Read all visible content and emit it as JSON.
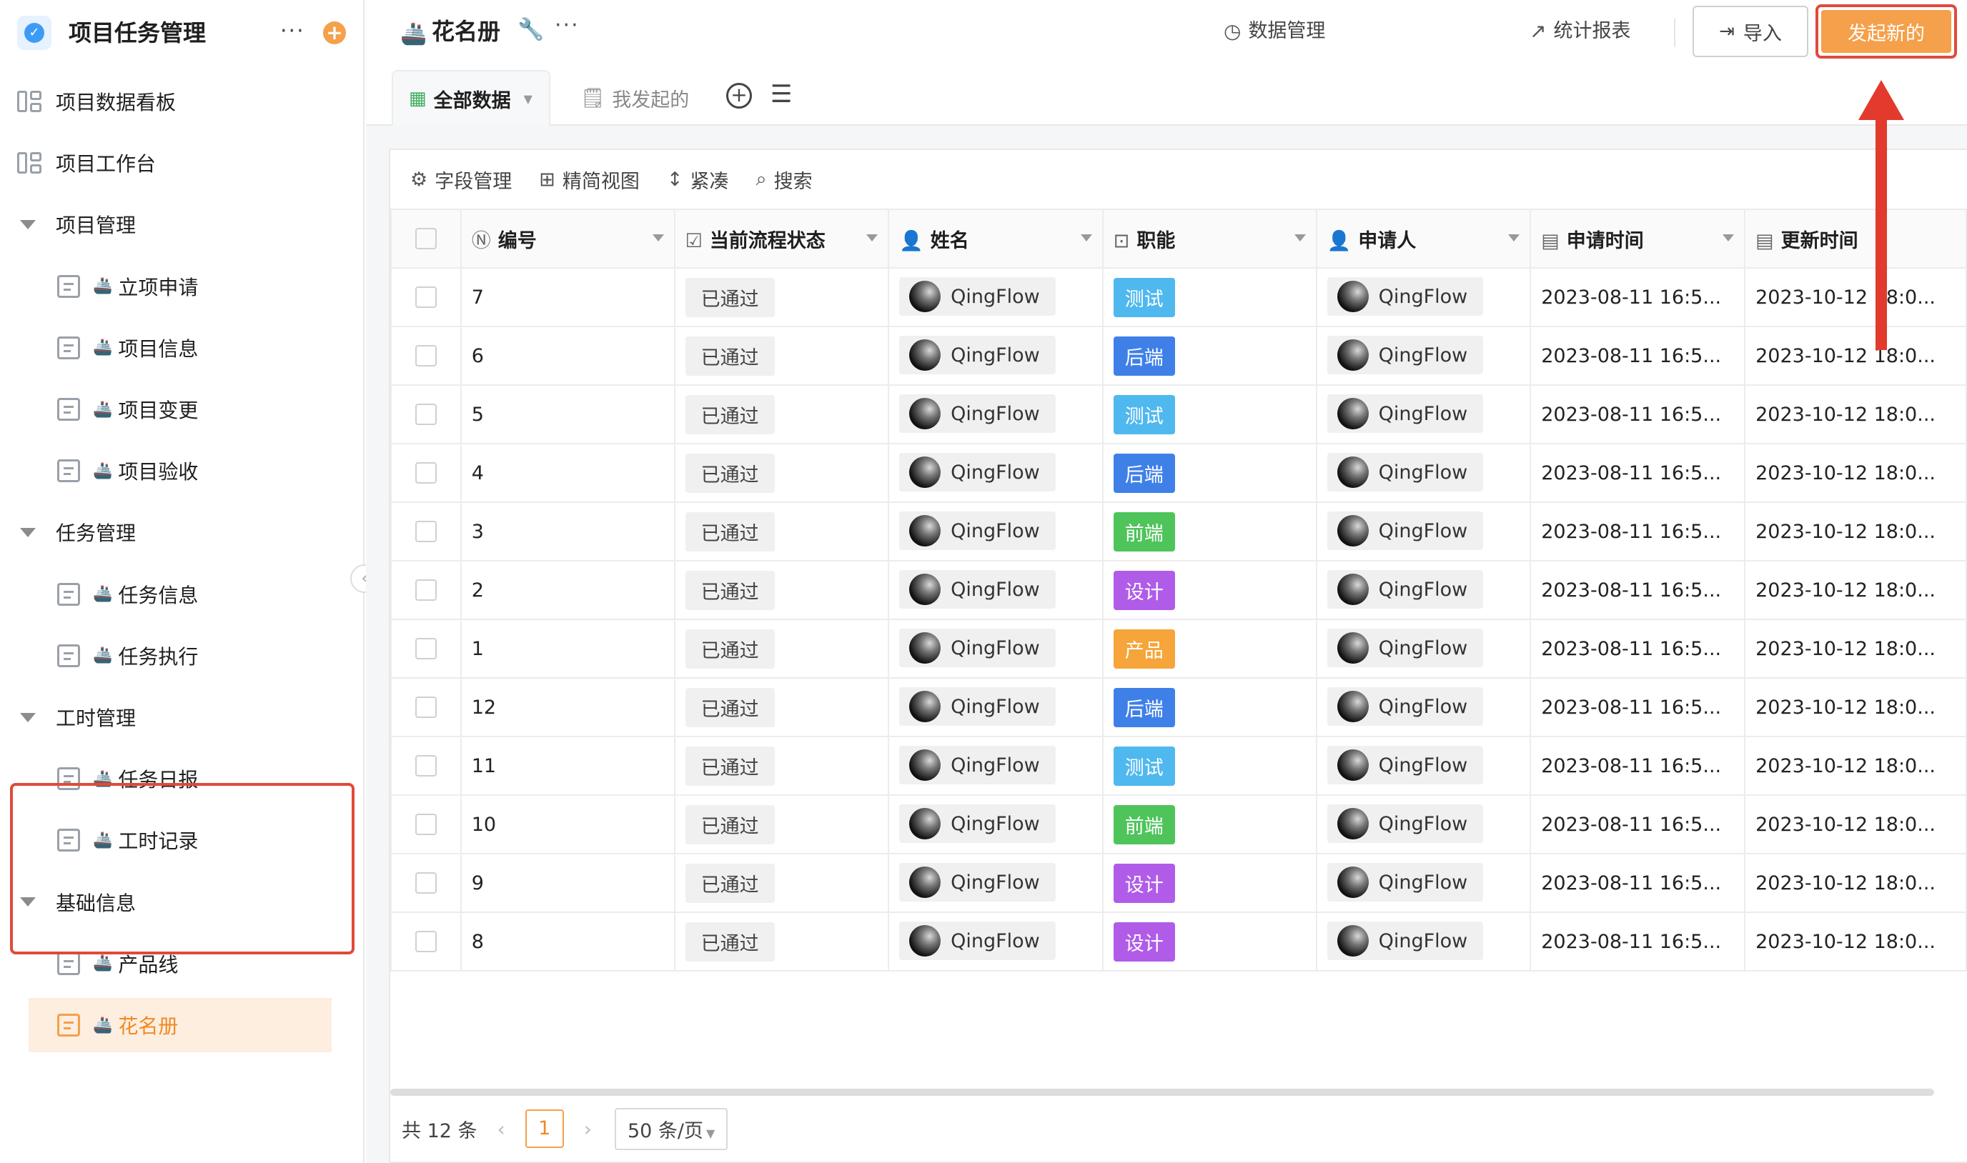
{
  "sidebar": {
    "app_title": "项目任务管理",
    "more": "···",
    "add": "+",
    "collapse": "‹",
    "items": [
      {
        "label": "项目数据看板",
        "type": "board"
      },
      {
        "label": "项目工作台",
        "type": "board"
      },
      {
        "label": "项目管理",
        "type": "group"
      },
      {
        "label": "立项申请",
        "type": "form"
      },
      {
        "label": "项目信息",
        "type": "form"
      },
      {
        "label": "项目变更",
        "type": "form"
      },
      {
        "label": "项目验收",
        "type": "form"
      },
      {
        "label": "任务管理",
        "type": "group"
      },
      {
        "label": "任务信息",
        "type": "form"
      },
      {
        "label": "任务执行",
        "type": "form"
      },
      {
        "label": "工时管理",
        "type": "group"
      },
      {
        "label": "任务日报",
        "type": "form"
      },
      {
        "label": "工时记录",
        "type": "form"
      },
      {
        "label": "基础信息",
        "type": "group"
      },
      {
        "label": "产品线",
        "type": "form"
      },
      {
        "label": "花名册",
        "type": "form",
        "active": true
      }
    ]
  },
  "header": {
    "title": "花名册",
    "data_mgmt": "数据管理",
    "stats": "统计报表",
    "import": "导入",
    "new": "发起新的"
  },
  "tabs": {
    "all": "全部数据",
    "mine": "我发起的"
  },
  "toolbar": {
    "fields": "字段管理",
    "simple_view": "精简视图",
    "compact": "紧凑",
    "search": "搜索"
  },
  "table": {
    "columns": [
      "编号",
      "当前流程状态",
      "姓名",
      "职能",
      "申请人",
      "申请时间",
      "更新时间"
    ],
    "rows": [
      {
        "id": "7",
        "status": "已通过",
        "name": "QingFlow",
        "role": "测试",
        "applicant": "QingFlow",
        "applied": "2023-08-11 16:5...",
        "updated": "2023-10-12 18:0..."
      },
      {
        "id": "6",
        "status": "已通过",
        "name": "QingFlow",
        "role": "后端",
        "applicant": "QingFlow",
        "applied": "2023-08-11 16:5...",
        "updated": "2023-10-12 18:0..."
      },
      {
        "id": "5",
        "status": "已通过",
        "name": "QingFlow",
        "role": "测试",
        "applicant": "QingFlow",
        "applied": "2023-08-11 16:5...",
        "updated": "2023-10-12 18:0..."
      },
      {
        "id": "4",
        "status": "已通过",
        "name": "QingFlow",
        "role": "后端",
        "applicant": "QingFlow",
        "applied": "2023-08-11 16:5...",
        "updated": "2023-10-12 18:0..."
      },
      {
        "id": "3",
        "status": "已通过",
        "name": "QingFlow",
        "role": "前端",
        "applicant": "QingFlow",
        "applied": "2023-08-11 16:5...",
        "updated": "2023-10-12 18:0..."
      },
      {
        "id": "2",
        "status": "已通过",
        "name": "QingFlow",
        "role": "设计",
        "applicant": "QingFlow",
        "applied": "2023-08-11 16:5...",
        "updated": "2023-10-12 18:0..."
      },
      {
        "id": "1",
        "status": "已通过",
        "name": "QingFlow",
        "role": "产品",
        "applicant": "QingFlow",
        "applied": "2023-08-11 16:5...",
        "updated": "2023-10-12 18:0..."
      },
      {
        "id": "12",
        "status": "已通过",
        "name": "QingFlow",
        "role": "后端",
        "applicant": "QingFlow",
        "applied": "2023-08-11 16:5...",
        "updated": "2023-10-12 18:0..."
      },
      {
        "id": "11",
        "status": "已通过",
        "name": "QingFlow",
        "role": "测试",
        "applicant": "QingFlow",
        "applied": "2023-08-11 16:5...",
        "updated": "2023-10-12 18:0..."
      },
      {
        "id": "10",
        "status": "已通过",
        "name": "QingFlow",
        "role": "前端",
        "applicant": "QingFlow",
        "applied": "2023-08-11 16:5...",
        "updated": "2023-10-12 18:0..."
      },
      {
        "id": "9",
        "status": "已通过",
        "name": "QingFlow",
        "role": "设计",
        "applicant": "QingFlow",
        "applied": "2023-08-11 16:5...",
        "updated": "2023-10-12 18:0..."
      },
      {
        "id": "8",
        "status": "已通过",
        "name": "QingFlow",
        "role": "设计",
        "applicant": "QingFlow",
        "applied": "2023-08-11 16:5...",
        "updated": "2023-10-12 18:0..."
      }
    ]
  },
  "role_colors": {
    "测试": "#4fb8ef",
    "后端": "#3f80e8",
    "前端": "#4ec45a",
    "设计": "#b05ce8",
    "产品": "#f5a53a"
  },
  "pagination": {
    "total": "共 12 条",
    "current_page": "1",
    "page_size": "50 条/页"
  },
  "colors": {
    "accent": "#f5a04a",
    "highlight_border": "#e04a3a"
  }
}
